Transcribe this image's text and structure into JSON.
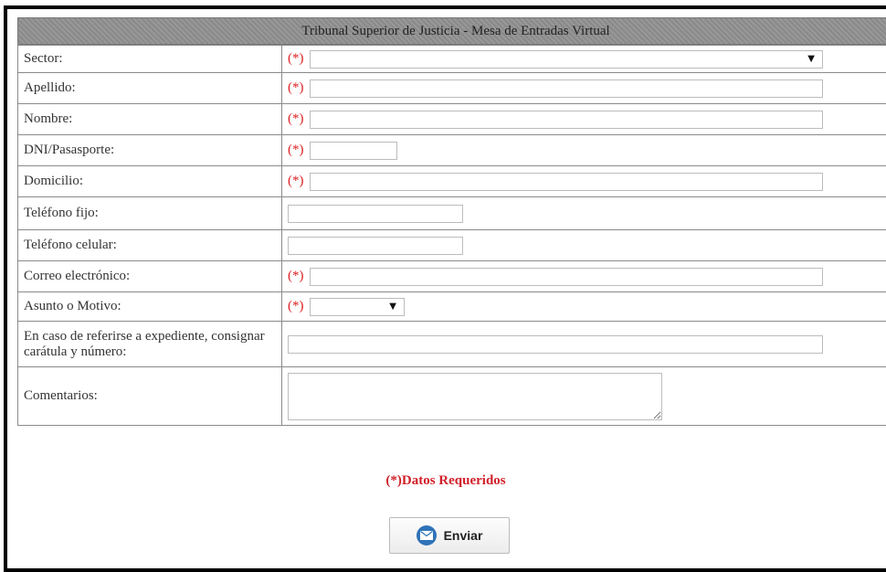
{
  "form": {
    "title": "Tribunal Superior de Justicia - Mesa de Entradas Virtual",
    "required_marker": "(*)",
    "fields": [
      {
        "label": "Sector:",
        "required": true,
        "type": "select",
        "value": ""
      },
      {
        "label": "Apellido:",
        "required": true,
        "type": "text",
        "value": ""
      },
      {
        "label": "Nombre:",
        "required": true,
        "type": "text",
        "value": ""
      },
      {
        "label": "DNI/Pasasporte:",
        "required": true,
        "type": "text",
        "value": ""
      },
      {
        "label": "Domicilio:",
        "required": true,
        "type": "text",
        "value": ""
      },
      {
        "label": "Teléfono fijo:",
        "required": false,
        "type": "text",
        "value": ""
      },
      {
        "label": "Teléfono celular:",
        "required": false,
        "type": "text",
        "value": ""
      },
      {
        "label": "Correo electrónico:",
        "required": true,
        "type": "text",
        "value": ""
      },
      {
        "label": "Asunto o Motivo:",
        "required": true,
        "type": "select",
        "value": ""
      },
      {
        "label": "En caso de referirse a expediente, consignar carátula y número:",
        "required": false,
        "type": "text",
        "value": ""
      },
      {
        "label": "Comentarios:",
        "required": false,
        "type": "textarea",
        "value": ""
      }
    ],
    "required_note": "(*)Datos Requeridos",
    "submit_label": "Enviar",
    "accent_red": "#d22020",
    "title_bg": "#8f8f8f",
    "submit_icon": "mail-icon"
  }
}
